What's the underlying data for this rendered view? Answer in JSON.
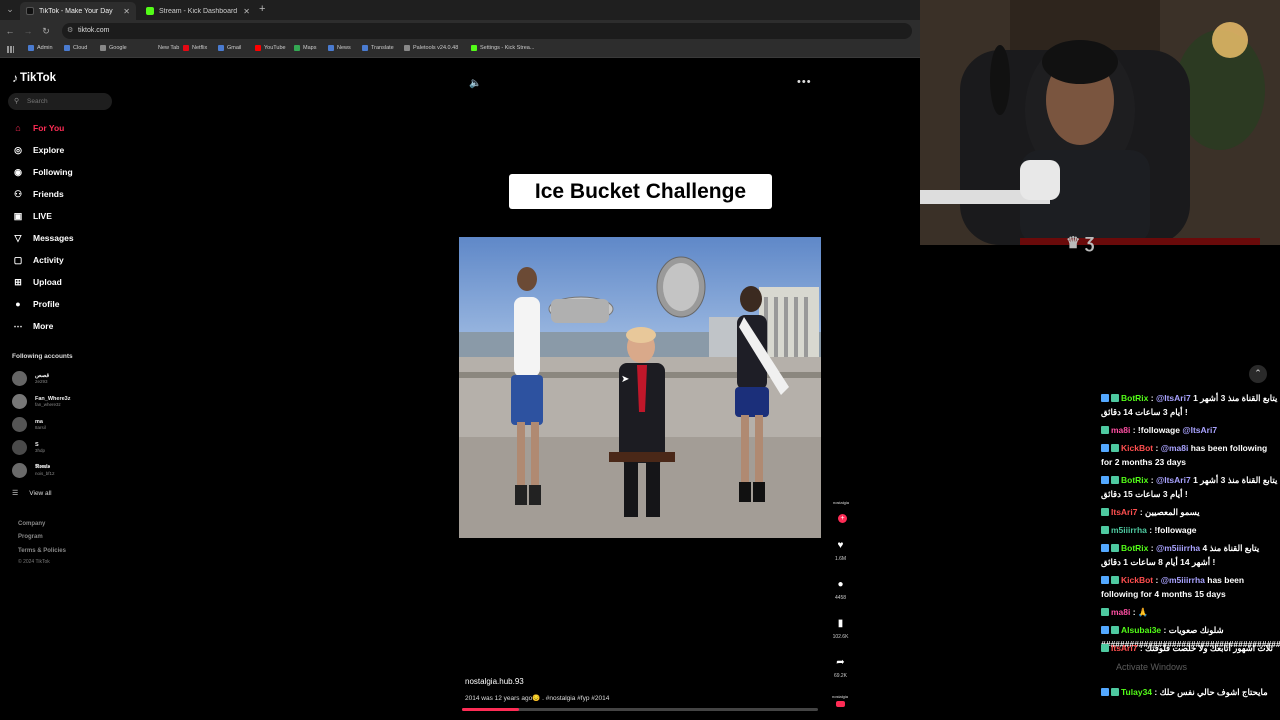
{
  "browser": {
    "tabs": [
      {
        "label": "TikTok - Make Your Day",
        "color": "#111111"
      },
      {
        "label": "Stream - Kick Dashboard",
        "color": "#53fc18"
      }
    ],
    "url": "tiktok.com",
    "bookmarks": [
      {
        "label": "Admin",
        "color": "#4a7bd0"
      },
      {
        "label": "Cloud",
        "color": "#4a7bd0"
      },
      {
        "label": "Google",
        "color": "#888888"
      },
      {
        "label": "New Tab",
        "color": "#2d2d2d"
      },
      {
        "label": "Netflix",
        "color": "#e50914"
      },
      {
        "label": "Gmail",
        "color": "#4a7bd0"
      },
      {
        "label": "YouTube",
        "color": "#ff0000"
      },
      {
        "label": "Maps",
        "color": "#34a853"
      },
      {
        "label": "News",
        "color": "#4a7bd0"
      },
      {
        "label": "Translate",
        "color": "#4a7bd0"
      },
      {
        "label": "Paletools v24.0.48",
        "color": "#888888"
      },
      {
        "label": "Settings - Kick Strea...",
        "color": "#53fc18"
      }
    ]
  },
  "sidebar": {
    "logo": "TikTok",
    "search_placeholder": "Search",
    "nav": [
      {
        "label": "For You",
        "icon": "home-icon",
        "glyph": "⌂",
        "active": true
      },
      {
        "label": "Explore",
        "icon": "compass-icon",
        "glyph": "◎",
        "active": false
      },
      {
        "label": "Following",
        "icon": "following-icon",
        "glyph": "◉",
        "active": false
      },
      {
        "label": "Friends",
        "icon": "friends-icon",
        "glyph": "⚇",
        "active": false
      },
      {
        "label": "LIVE",
        "icon": "live-icon",
        "glyph": "▣",
        "active": false
      },
      {
        "label": "Messages",
        "icon": "messages-icon",
        "glyph": "▽",
        "active": false
      },
      {
        "label": "Activity",
        "icon": "activity-icon",
        "glyph": "▢",
        "active": false
      },
      {
        "label": "Upload",
        "icon": "upload-icon",
        "glyph": "⊞",
        "active": false
      },
      {
        "label": "Profile",
        "icon": "profile-icon",
        "glyph": "●",
        "active": false
      },
      {
        "label": "More",
        "icon": "more-icon",
        "glyph": "⋯",
        "active": false
      }
    ],
    "following_title": "Following accounts",
    "accounts": [
      {
        "name": "قصص",
        "handle": "2e293"
      },
      {
        "name": "Fan_Where3z",
        "handle": "fan_where3z"
      },
      {
        "name": "ma",
        "handle": "8arsil"
      },
      {
        "name": "S",
        "handle": "3hdp"
      },
      {
        "name": "𝕹𝖔𝖒𝖎𝖘",
        "handle": "nois_bf12"
      }
    ],
    "view_all": "View all",
    "footer": [
      "Company",
      "Program",
      "Terms & Policies"
    ],
    "copyright": "© 2024 TikTok"
  },
  "video": {
    "title_card": "Ice Bucket Challenge",
    "author": "nostalgia.hub.93",
    "description": "2014 was 12 years ago😔 . #nostalgia #fyp #2014",
    "progress": 0.16,
    "actions": {
      "avatar_name": "nostalgia",
      "likes": "1.6M",
      "comments": "4458",
      "saves": "102.6K",
      "shares": "69.2K",
      "music_name": "nostalgia"
    }
  },
  "chat": {
    "messages": [
      {
        "user": "BotRix",
        "user_color": "#53fc18",
        "badges": [
          "b",
          "g"
        ],
        "segments": [
          {
            "t": " : "
          },
          {
            "t": "@ItsAri7",
            "m": true
          },
          {
            "t": " يتابع القناة منذ 3 أشهر 1 أيام 3 ساعات 14 دقائق !"
          }
        ]
      },
      {
        "user": "ma8i",
        "user_color": "#ff4fa3",
        "badges": [
          "g"
        ],
        "segments": [
          {
            "t": " : !followage "
          },
          {
            "t": "@ItsAri7",
            "m": true
          }
        ]
      },
      {
        "user": "KickBot",
        "user_color": "#ff4f4f",
        "badges": [
          "b",
          "g"
        ],
        "segments": [
          {
            "t": " : "
          },
          {
            "t": "@ma8i",
            "m": true
          },
          {
            "t": " has been following for 2 months 23 days"
          }
        ]
      },
      {
        "user": "BotRix",
        "user_color": "#53fc18",
        "badges": [
          "b",
          "g"
        ],
        "segments": [
          {
            "t": " : "
          },
          {
            "t": "@ItsAri7",
            "m": true
          },
          {
            "t": " يتابع القناة منذ 3 أشهر 1 أيام 3 ساعات 15 دقائق !"
          }
        ]
      },
      {
        "user": "ItsAri7",
        "user_color": "#ff4f4f",
        "badges": [
          "g"
        ],
        "segments": [
          {
            "t": " : يسمو المعصيين"
          }
        ]
      },
      {
        "user": "m5iiirrha",
        "user_color": "#4ec9a0",
        "badges": [
          "g"
        ],
        "segments": [
          {
            "t": " : !followage"
          }
        ]
      },
      {
        "user": "BotRix",
        "user_color": "#53fc18",
        "badges": [
          "b",
          "g"
        ],
        "segments": [
          {
            "t": " : "
          },
          {
            "t": "@m5iiirrha",
            "m": true
          },
          {
            "t": " يتابع القناة منذ 4 أشهر 14 أيام 8 ساعات 1 دقائق !"
          }
        ]
      },
      {
        "user": "KickBot",
        "user_color": "#ff4f4f",
        "badges": [
          "b",
          "g"
        ],
        "segments": [
          {
            "t": " : "
          },
          {
            "t": "@m5iiirrha",
            "m": true
          },
          {
            "t": " has been following for 4 months 15 days"
          }
        ]
      },
      {
        "user": "ma8i",
        "user_color": "#ff4fa3",
        "badges": [
          "g"
        ],
        "segments": [
          {
            "t": " : 🙏"
          }
        ]
      },
      {
        "user": "Alsubai3e",
        "user_color": "#53fc18",
        "badges": [
          "b",
          "g"
        ],
        "segments": [
          {
            "t": " : شلونك صعويات ########################################"
          }
        ]
      },
      {
        "user": "ItsAri7",
        "user_color": "#ff4f4f",
        "badges": [
          "g"
        ],
        "segments": [
          {
            "t": " : ثلاث اشهور أتابعك ولا خلصت فلوقتك"
          }
        ]
      },
      {
        "user": "Tulay34",
        "user_color": "#53fc18",
        "badges": [
          "b",
          "g"
        ],
        "segments": [
          {
            "t": " : مايحتاج اشوف حالي نفس حلك"
          }
        ]
      }
    ],
    "watermark": "Activate Windows"
  }
}
